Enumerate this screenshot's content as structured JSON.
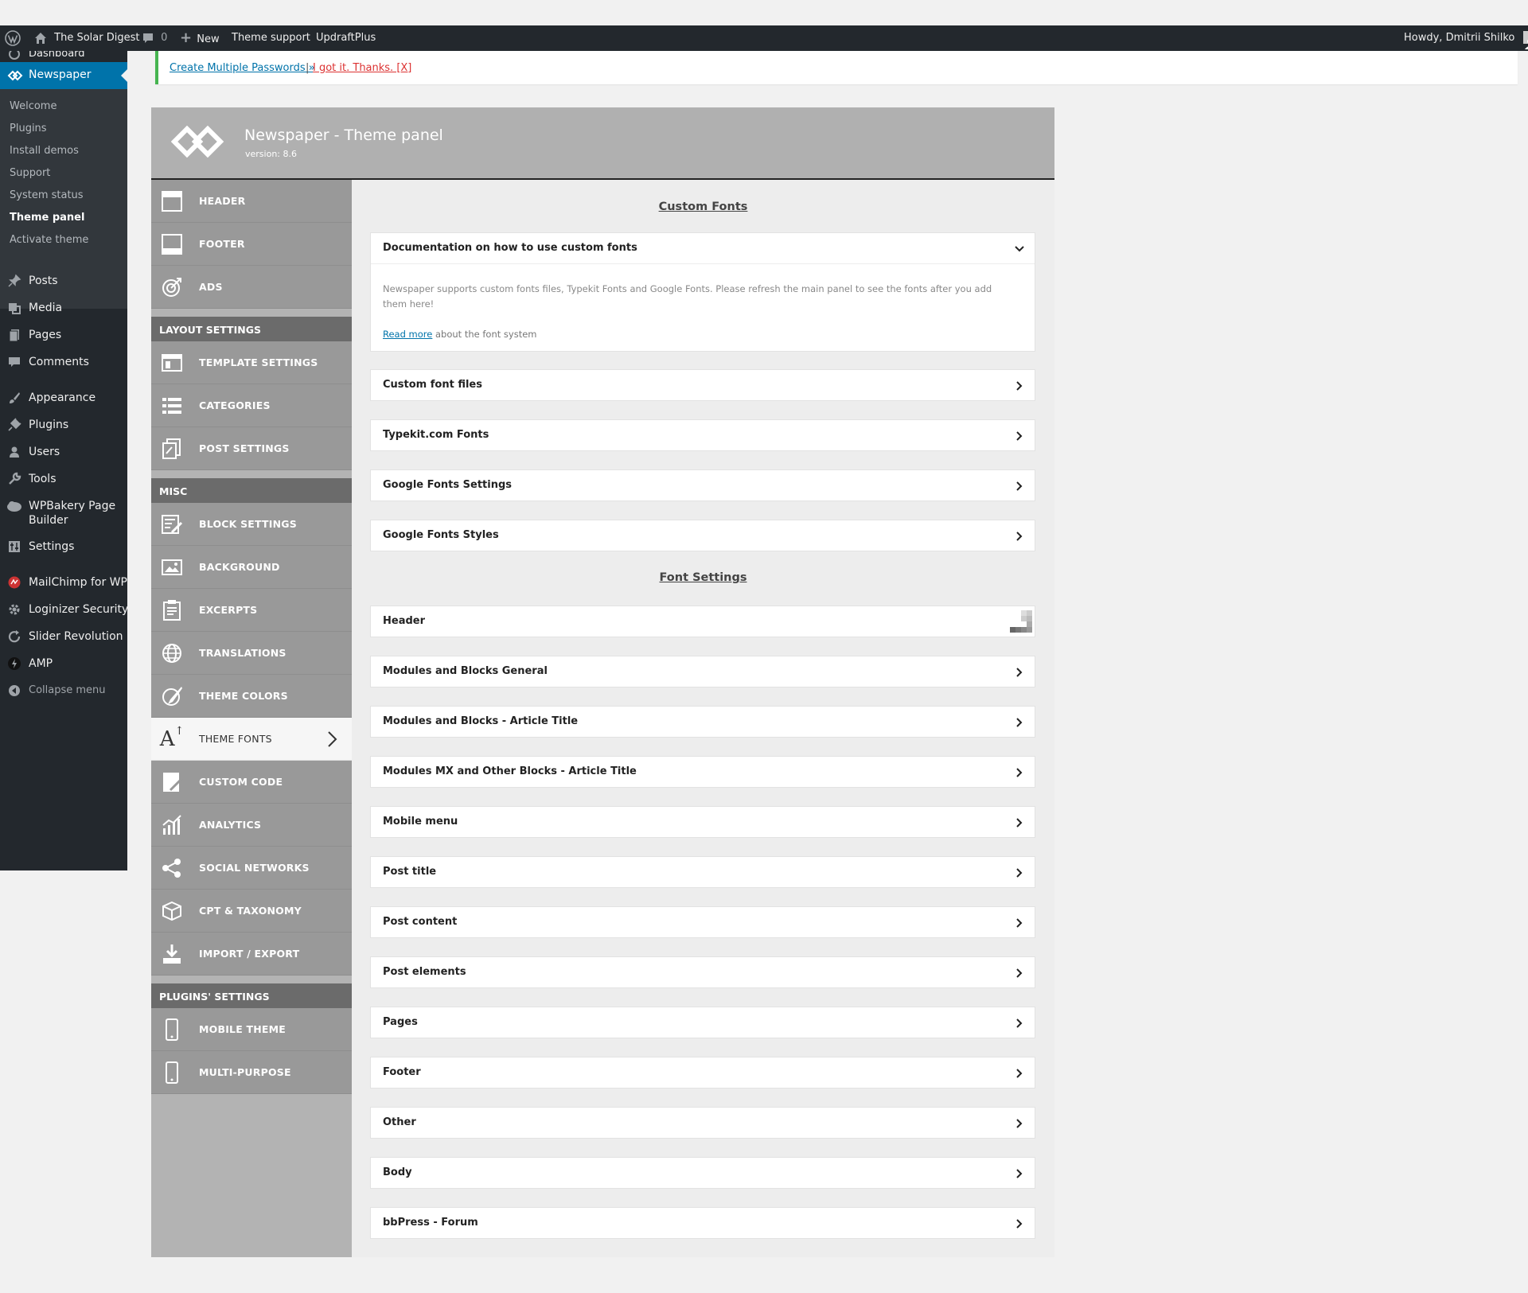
{
  "admin_bar": {
    "site_name": "The Solar Digest",
    "comments_count": "0",
    "new_label": "New",
    "theme_support": "Theme support",
    "updraft": "UpdraftPlus",
    "howdy": "Howdy, Dmitrii Shilko"
  },
  "admin_menu": {
    "partial_top": "Dashboard",
    "current": "Newspaper",
    "submenu": [
      "Welcome",
      "Plugins",
      "Install demos",
      "Support",
      "System status",
      "Theme panel",
      "Activate theme"
    ],
    "items": [
      "Posts",
      "Media",
      "Pages",
      "Comments",
      "Appearance",
      "Plugins",
      "Users",
      "Tools",
      "WPBakery Page Builder",
      "Settings",
      "MailChimp for WP",
      "Loginizer Security",
      "Slider Revolution",
      "AMP",
      "Collapse menu"
    ],
    "wpbakery_line1": "WPBakery Page",
    "wpbakery_line2": "Builder"
  },
  "notice": {
    "link1": "Create Multiple Passwords »",
    "separator": "|",
    "link2": "I got it. Thanks. [X]"
  },
  "panel": {
    "title": "Newspaper - Theme panel",
    "version": "version: 8.6"
  },
  "sidebar": {
    "items": [
      "HEADER",
      "FOOTER",
      "ADS",
      "TEMPLATE SETTINGS",
      "CATEGORIES",
      "POST SETTINGS",
      "BLOCK SETTINGS",
      "BACKGROUND",
      "EXCERPTS",
      "TRANSLATIONS",
      "THEME COLORS",
      "THEME FONTS",
      "CUSTOM CODE",
      "ANALYTICS",
      "SOCIAL NETWORKS",
      "CPT & TAXONOMY",
      "IMPORT / EXPORT",
      "MOBILE THEME",
      "MULTI-PURPOSE"
    ],
    "categories": [
      "LAYOUT SETTINGS",
      "MISC",
      "PLUGINS' SETTINGS"
    ],
    "active": "THEME FONTS"
  },
  "content": {
    "custom_fonts_title": "Custom Fonts",
    "doc_title": "Documentation on how to use custom fonts",
    "doc_text": "Newspaper supports custom fonts files, Typekit Fonts and Google Fonts. Please refresh the main panel to see the fonts after you add them here!",
    "read_more": "Read more",
    "read_more_tail": " about the font system",
    "custom_sections": [
      "Custom font files",
      "Typekit.com Fonts",
      "Google Fonts Settings",
      "Google Fonts Styles"
    ],
    "font_settings_title": "Font Settings",
    "font_sections": [
      "Header",
      "Modules and Blocks General",
      "Modules and Blocks - Article Title",
      "Modules MX and Other Blocks - Article Title",
      "Mobile menu",
      "Post title",
      "Post content",
      "Post elements",
      "Pages",
      "Footer",
      "Other",
      "Body",
      "bbPress - Forum"
    ]
  },
  "colors": {
    "admin_bar": "#23282d",
    "wp_blue": "#0073aa",
    "notice_green": "#46b450",
    "sidebar_item": "#999999",
    "category_bar": "#6b6b6b"
  }
}
